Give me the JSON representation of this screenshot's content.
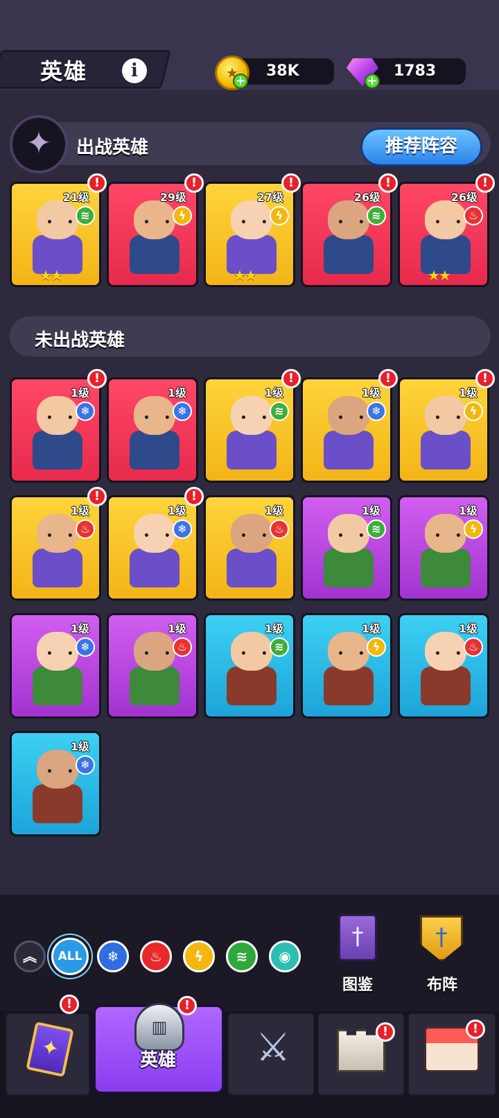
{
  "header": {
    "title": "英雄",
    "coins": "38K",
    "gems": "1783"
  },
  "active_section": {
    "title": "出战英雄",
    "recommend_label": "推荐阵容"
  },
  "active_heroes": [
    {
      "level": "21级",
      "element": "wind",
      "stars": "★★",
      "bg": "yellow",
      "alert": true
    },
    {
      "level": "29级",
      "element": "thunder",
      "stars": "",
      "bg": "red",
      "alert": true
    },
    {
      "level": "27级",
      "element": "thunder",
      "stars": "★★",
      "bg": "yellow",
      "alert": true
    },
    {
      "level": "26级",
      "element": "wind",
      "stars": "",
      "bg": "red",
      "alert": true
    },
    {
      "level": "26级",
      "element": "fire",
      "stars": "★★",
      "bg": "red",
      "alert": true
    }
  ],
  "inactive_section": {
    "title": "未出战英雄"
  },
  "inactive_heroes": [
    {
      "level": "1级",
      "element": "ice",
      "bg": "red",
      "alert": true
    },
    {
      "level": "1级",
      "element": "ice",
      "bg": "red",
      "alert": false
    },
    {
      "level": "1级",
      "element": "wind",
      "bg": "yellow",
      "alert": true
    },
    {
      "level": "1级",
      "element": "ice",
      "bg": "yellow",
      "alert": true
    },
    {
      "level": "1级",
      "element": "thunder",
      "bg": "yellow",
      "alert": true
    },
    {
      "level": "1级",
      "element": "fire",
      "bg": "yellow",
      "alert": true
    },
    {
      "level": "1级",
      "element": "ice",
      "bg": "yellow",
      "alert": true
    },
    {
      "level": "1级",
      "element": "fire",
      "bg": "yellow",
      "alert": false
    },
    {
      "level": "1级",
      "element": "wind",
      "bg": "purple",
      "alert": false
    },
    {
      "level": "1级",
      "element": "thunder",
      "bg": "purple",
      "alert": false
    },
    {
      "level": "1级",
      "element": "ice",
      "bg": "purple",
      "alert": false
    },
    {
      "level": "1级",
      "element": "fire",
      "bg": "purple",
      "alert": false
    },
    {
      "level": "1级",
      "element": "wind",
      "bg": "blue",
      "alert": false
    },
    {
      "level": "1级",
      "element": "thunder",
      "bg": "blue",
      "alert": false
    },
    {
      "level": "1级",
      "element": "fire",
      "bg": "blue",
      "alert": false
    },
    {
      "level": "1级",
      "element": "ice",
      "bg": "blue",
      "alert": false
    }
  ],
  "filters": {
    "all_label": "ALL"
  },
  "side_buttons": {
    "codex_label": "图鉴",
    "formation_label": "布阵"
  },
  "tabs": {
    "heroes_label": "英雄"
  }
}
